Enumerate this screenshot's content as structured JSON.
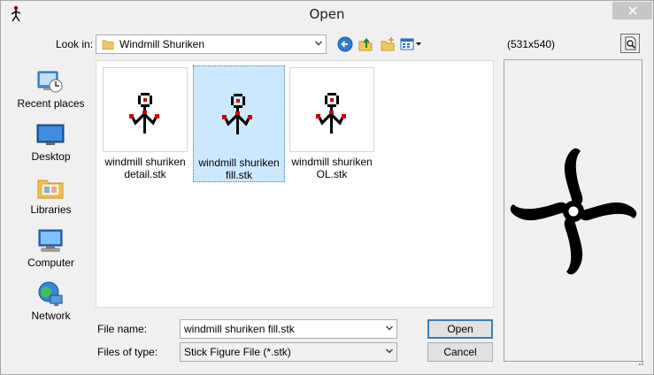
{
  "window": {
    "title": "Open"
  },
  "toolbar": {
    "look_in_label": "Look in:",
    "look_in_value": "Windmill Shuriken",
    "dimensions": "(531x540)"
  },
  "places": [
    {
      "label": "Recent places",
      "icon": "recent-places-icon"
    },
    {
      "label": "Desktop",
      "icon": "desktop-icon"
    },
    {
      "label": "Libraries",
      "icon": "libraries-icon"
    },
    {
      "label": "Computer",
      "icon": "computer-icon"
    },
    {
      "label": "Network",
      "icon": "network-icon"
    }
  ],
  "files": [
    {
      "name": "windmill shuriken detail.stk",
      "selected": false
    },
    {
      "name": "windmill shuriken fill.stk",
      "selected": true
    },
    {
      "name": "windmill shuriken OL.stk",
      "selected": false
    }
  ],
  "form": {
    "file_name_label": "File name:",
    "file_name_value": "windmill shuriken fill.stk",
    "file_type_label": "Files of type:",
    "file_type_value": "Stick Figure File (*.stk)"
  },
  "buttons": {
    "open": "Open",
    "cancel": "Cancel"
  },
  "colors": {
    "selection": "#cce8ff",
    "accent": "#3c7fb1",
    "figure_joint": "#d40000"
  }
}
